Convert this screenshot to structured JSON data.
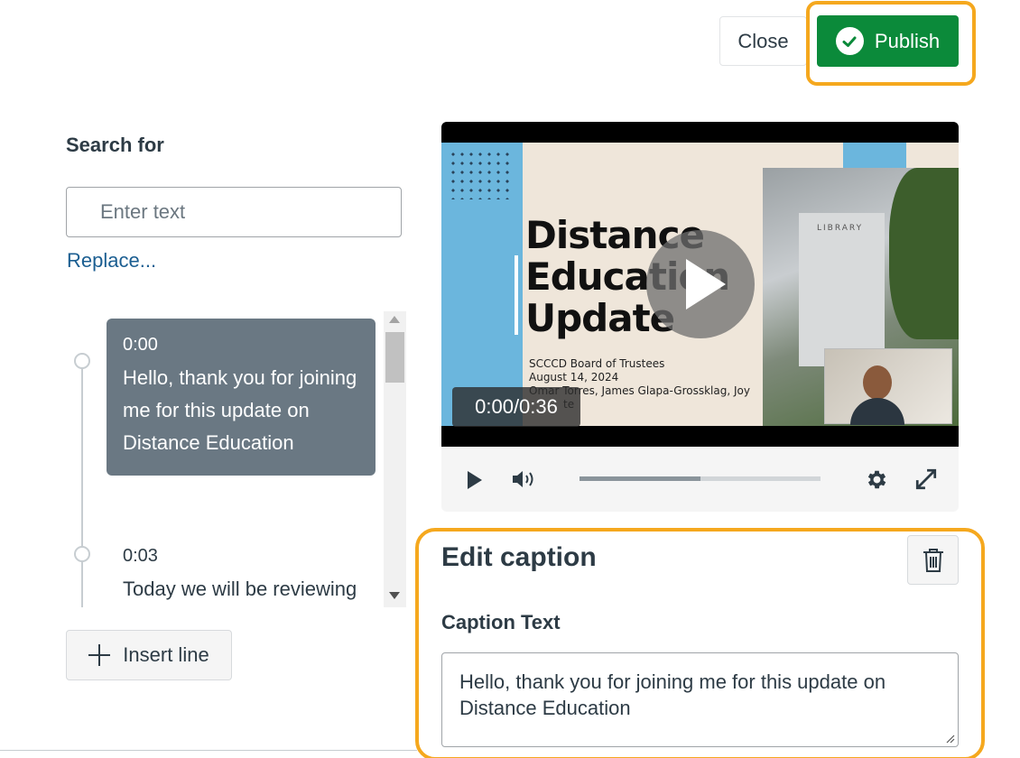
{
  "header": {
    "close_label": "Close",
    "publish_label": "Publish"
  },
  "search": {
    "label": "Search for",
    "placeholder": "Enter text",
    "replace_link": "Replace..."
  },
  "captions": [
    {
      "time": "0:00",
      "text": "Hello, thank you for joining me for this update on Distance Education",
      "active": true
    },
    {
      "time": "0:03",
      "text": "Today we will be reviewing some of the",
      "active": false
    }
  ],
  "insert_label": "Insert line",
  "player": {
    "time_display": "0:00/0:36",
    "progress": 0.5,
    "slide": {
      "title_line1": "Distance",
      "title_line2": "Education",
      "title_line3": "Update",
      "sub_line1": "SCCCD Board of Trustees",
      "sub_line2": "August 14, 2024",
      "sub_line3": "Omar Torres, James Glapa-Grossklag, Joy",
      "sub_line4": "te",
      "photo_sign": "LIBRARY"
    }
  },
  "edit_caption": {
    "title": "Edit caption",
    "field_label": "Caption Text",
    "value": "Hello, thank you for joining me for this update on Distance Education"
  },
  "colors": {
    "publish": "#0b8a3a",
    "highlight": "#f5a81e",
    "active_caption": "#6a7883",
    "link": "#1b5e91"
  },
  "icons": [
    "check-circle-icon",
    "plus-icon",
    "play-icon",
    "volume-icon",
    "gear-icon",
    "expand-icon",
    "trash-icon"
  ]
}
